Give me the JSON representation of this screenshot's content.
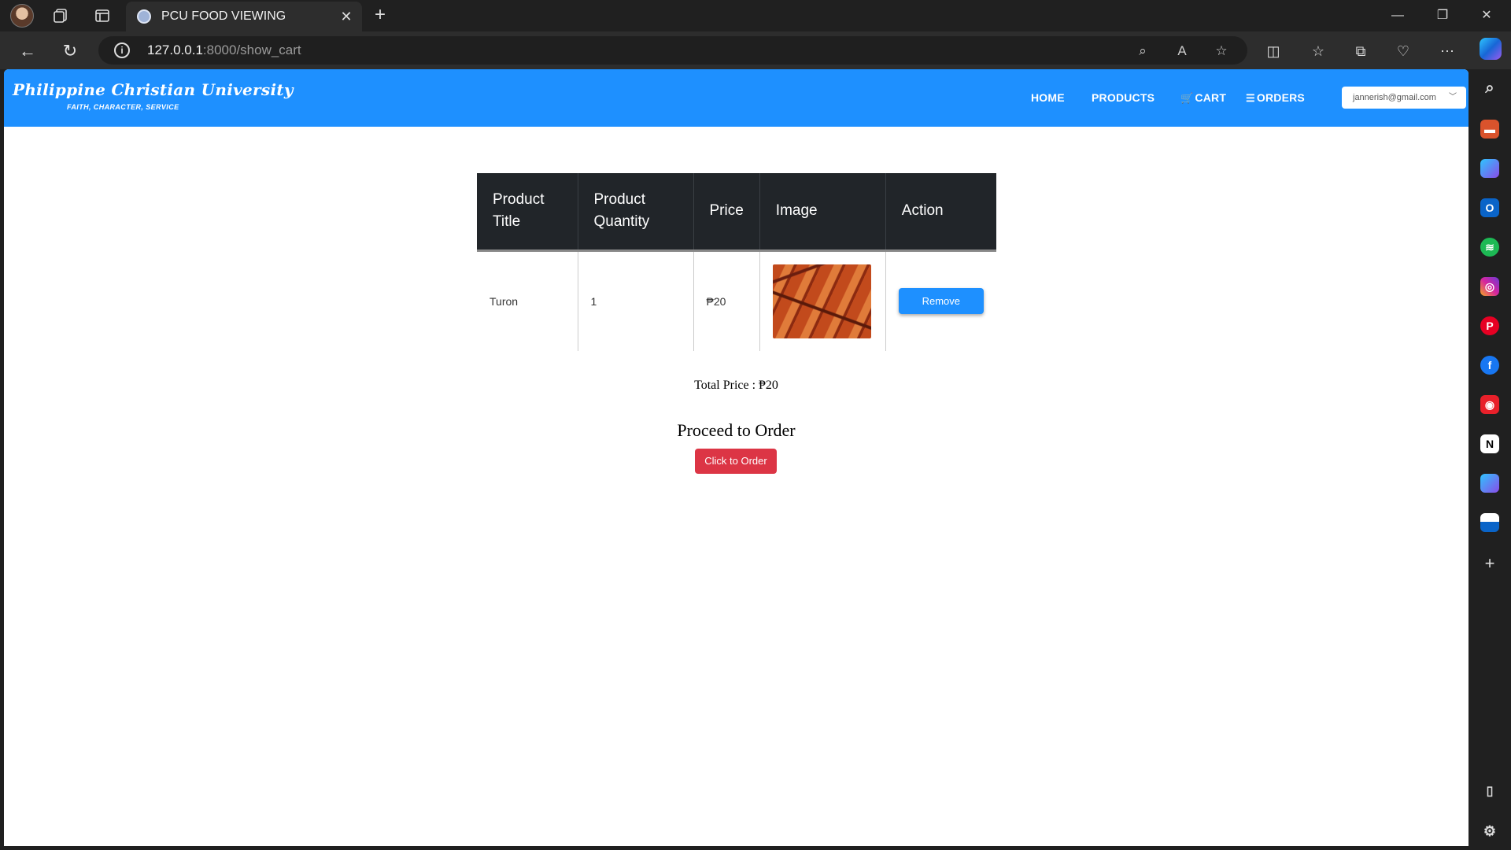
{
  "browser": {
    "tab_title": "PCU FOOD VIEWING",
    "url_host": "127.0.0.1",
    "url_path": ":8000/show_cart"
  },
  "header": {
    "logo_text": "Philippine Christian University",
    "tagline": "FAITH, CHARACTER, SERVICE",
    "nav": {
      "home": "HOME",
      "products": "PRODUCTS",
      "cart": "CART",
      "orders": "ORDERS"
    },
    "user_email": "jannerish@gmail.com"
  },
  "cart": {
    "columns": [
      "Product Title",
      "Product Quantity",
      "Price",
      "Image",
      "Action"
    ],
    "rows": [
      {
        "title": "Turon",
        "quantity": "1",
        "price": "₱20",
        "action_label": "Remove"
      }
    ]
  },
  "total_price_text": "Total Price : ₱20",
  "proceed_heading": "Proceed to Order",
  "order_button_label": "Click to Order",
  "colors": {
    "header_blue": "#1e90ff",
    "table_header": "#212529",
    "order_red": "#dc3545"
  }
}
